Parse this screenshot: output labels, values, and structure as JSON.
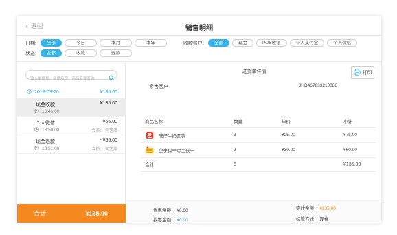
{
  "colors": {
    "accent": "#35b3e8",
    "total_bar": "#f5881f",
    "link_blue": "#35a8e0"
  },
  "header": {
    "back_label": "返回",
    "title": "销售明细"
  },
  "filters": {
    "date_label": "日期:",
    "date_options": [
      "全部",
      "今日",
      "本月",
      "本年"
    ],
    "status_label": "状态:",
    "status_options": [
      "全部",
      "收款",
      "退款"
    ],
    "payment_label": "收款账户:",
    "payment_options": [
      "全部",
      "现金",
      "POS收银",
      "个人支付宝",
      "个人微信"
    ],
    "active": {
      "date": "全部",
      "status": "全部",
      "payment": "全部"
    }
  },
  "search": {
    "placeholder": "输入单据号、会员名称、商品名称查询",
    "icon": "search-icon"
  },
  "day_group": {
    "date": "2018-03-20",
    "total": "¥135.00"
  },
  "orders": [
    {
      "name": "现金收款",
      "amount": "¥135.00",
      "time": "10:46:00",
      "staff": "",
      "selected": true
    },
    {
      "name": "个人微信",
      "amount": "¥65.00",
      "time": "13:50:00",
      "staff": "会员： 何艺泽",
      "selected": false
    },
    {
      "name": "现金退款",
      "amount": "- ¥65.00",
      "time": "13:51:00",
      "staff": "会员： 何艺泽",
      "selected": false
    }
  ],
  "left_total": {
    "label": "合计:",
    "value": "¥135.00"
  },
  "detail": {
    "title": "进货单详情",
    "print_label": "打印",
    "customer": "零售客户",
    "order_no": "JHD467833210088",
    "columns": [
      "商品名称",
      "数量",
      "单价",
      "小计"
    ],
    "items": [
      {
        "name": "旺仔牛奶套装",
        "qty": "3",
        "price": "¥25.00",
        "subtotal": "¥75.00",
        "thumb": "wangzai-milk-thumb"
      },
      {
        "name": "华夫饼干买二送一",
        "qty": "2",
        "price": "¥30.00",
        "subtotal": "¥60.00",
        "thumb": "waffle-biscuit-thumb"
      }
    ],
    "sum": {
      "label": "合计",
      "qty": "5",
      "subtotal": "¥135.00"
    }
  },
  "footer": {
    "discount_label": "优惠金额：",
    "discount_value": "¥0.00",
    "change_label": "找零金额：",
    "change_value": "¥0.00",
    "paid_label": "实收金额：",
    "paid_value": "¥135.00",
    "method_label": "结算方式：",
    "method_value": "现金"
  }
}
